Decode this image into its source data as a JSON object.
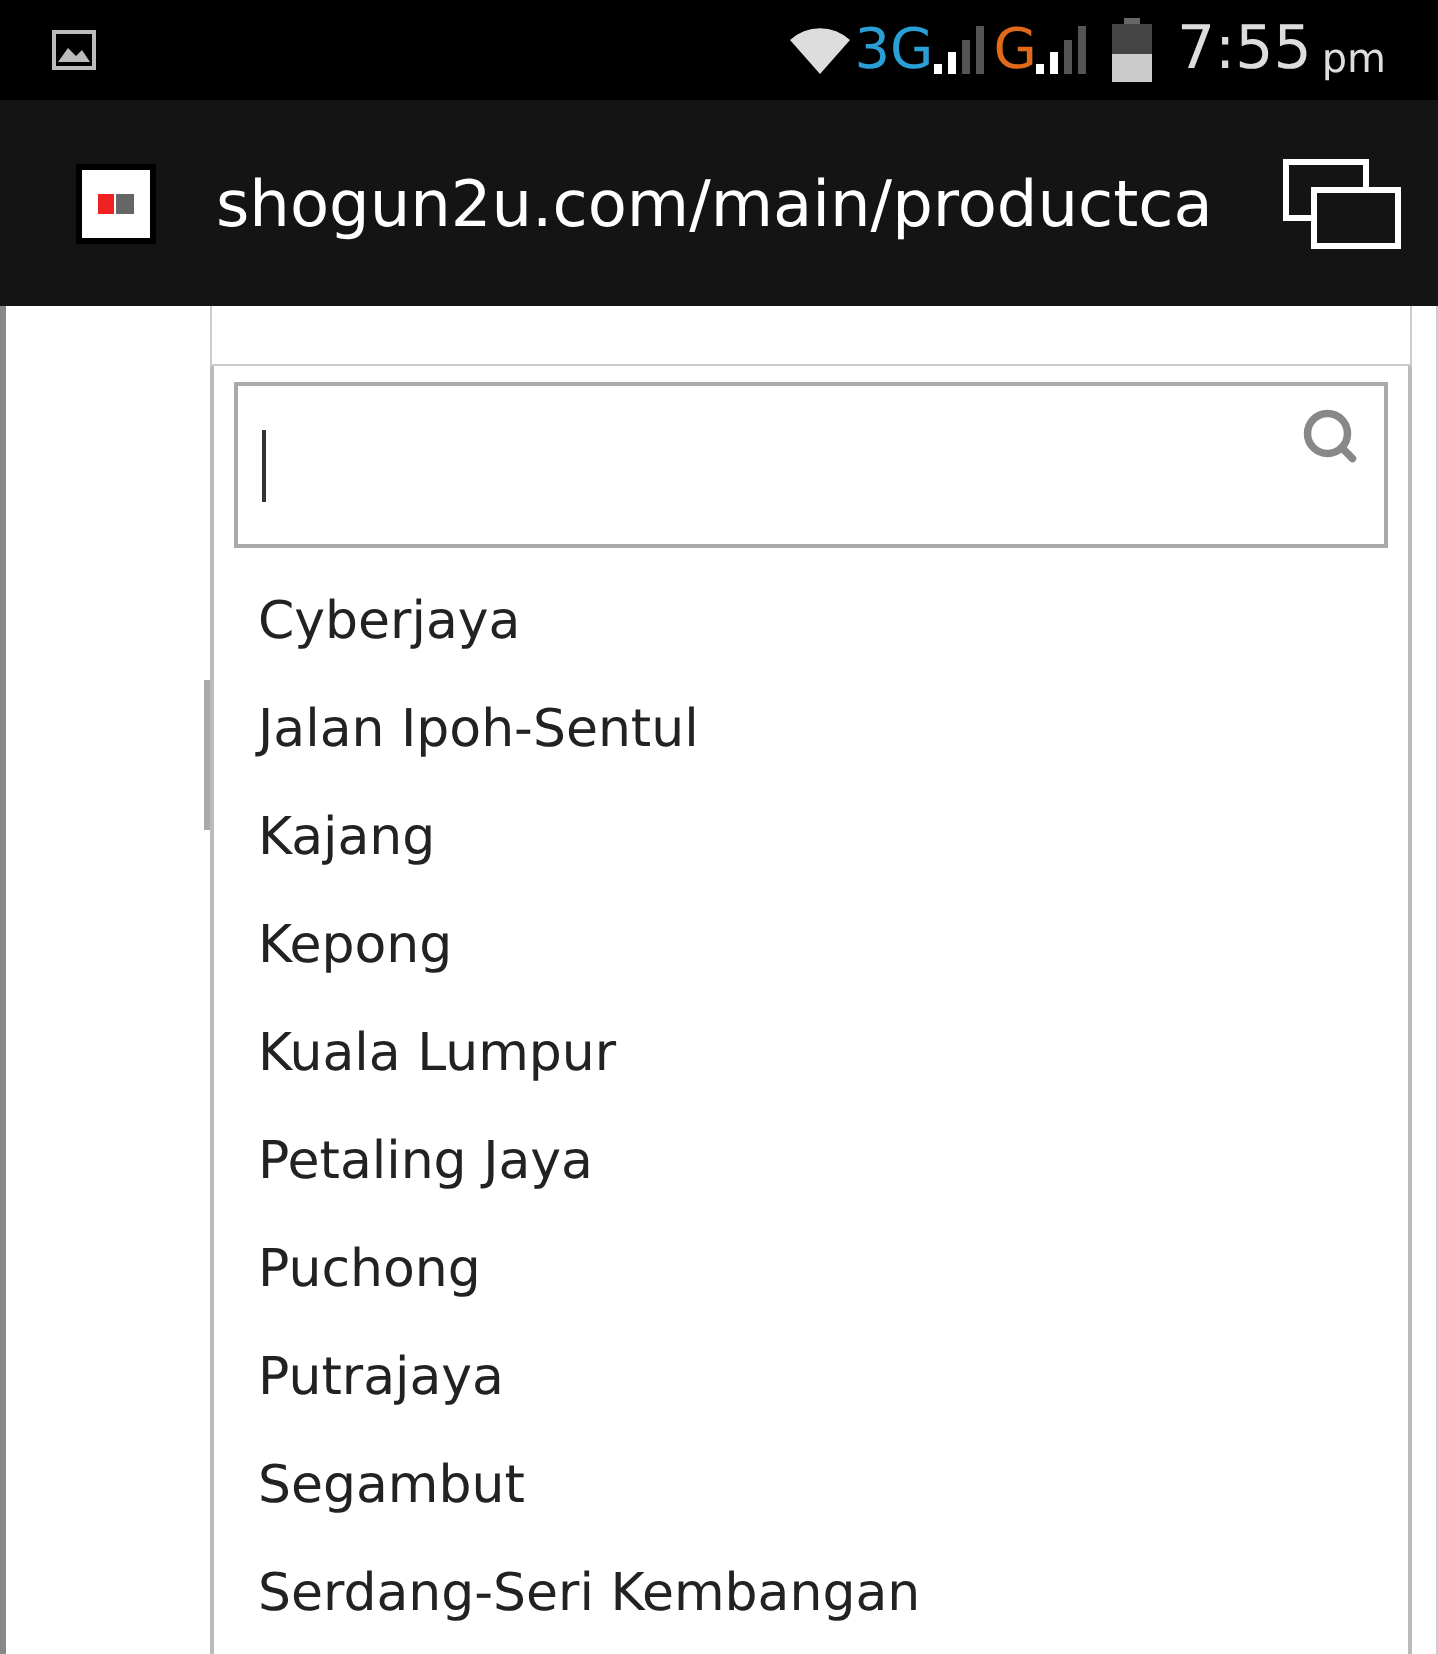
{
  "status_bar": {
    "network_1": "3G",
    "network_2": "G",
    "time": "7:55",
    "ampm": "pm"
  },
  "address_bar": {
    "url": "shogun2u.com/main/productca"
  },
  "dropdown": {
    "options": [
      {
        "label": "Cyberjaya"
      },
      {
        "label": "Jalan Ipoh-Sentul"
      },
      {
        "label": "Kajang"
      },
      {
        "label": "Kepong"
      },
      {
        "label": "Kuala Lumpur"
      },
      {
        "label": "Petaling Jaya"
      },
      {
        "label": "Puchong"
      },
      {
        "label": "Putrajaya"
      },
      {
        "label": "Segambut"
      },
      {
        "label": "Serdang-Seri Kembangan"
      }
    ]
  }
}
